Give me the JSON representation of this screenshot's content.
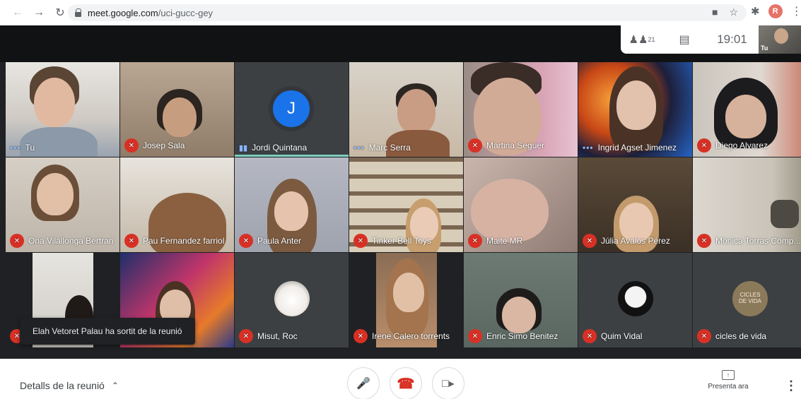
{
  "browser": {
    "url_host": "meet.google.com",
    "url_path": "/uci-gucc-gey",
    "profile_initial": "R"
  },
  "meet": {
    "participants_count": "21",
    "time": "19:01",
    "self_label": "Tu",
    "toast": "Elah Vetoret Palau ha sortit de la reunió",
    "avatar_j_letter": "J",
    "cicles_logo": "CICLES DE VIDA",
    "tiles": [
      {
        "name": "Tu",
        "state": "speaking-dots"
      },
      {
        "name": "Josep Sala",
        "state": "muted"
      },
      {
        "name": "Jordi Quintana",
        "state": "speaking-bars"
      },
      {
        "name": "Marc Serra",
        "state": "speaking-dots"
      },
      {
        "name": "Martina Seguer",
        "state": "muted"
      },
      {
        "name": "Ingrid Agset Jimenez",
        "state": "speaking-dots"
      },
      {
        "name": "Diego Alvarez",
        "state": "muted"
      },
      {
        "name": "Ona Vilallonga Bertran",
        "state": "muted"
      },
      {
        "name": "Pau Fernandez farriol",
        "state": "muted"
      },
      {
        "name": "Paula Anter",
        "state": "muted"
      },
      {
        "name": "Tinker Bell Toys",
        "state": "muted"
      },
      {
        "name": "Maite MR",
        "state": "muted"
      },
      {
        "name": "Júlia Avalos Pérez",
        "state": "muted"
      },
      {
        "name": "Mònica Torras Comp...",
        "state": "muted"
      },
      {
        "name": "",
        "state": "muted"
      },
      {
        "name": "",
        "state": "none"
      },
      {
        "name": "Misut, Roc",
        "state": "muted"
      },
      {
        "name": "Irene Calero torrents",
        "state": "muted"
      },
      {
        "name": "Enric Simo Benitez",
        "state": "muted"
      },
      {
        "name": "Quim Vidal",
        "state": "muted"
      },
      {
        "name": "cicles de vida",
        "state": "muted"
      }
    ]
  },
  "bottom_bar": {
    "details_label": "Detalls de la reunió",
    "present_label": "Presenta ara"
  },
  "icons": {
    "back": "back-arrow-icon",
    "forward": "forward-arrow-icon",
    "reload": "reload-icon",
    "lock": "lock-icon",
    "camera": "camera-icon",
    "star": "star-icon",
    "puzzle": "extensions-icon",
    "people": "people-icon",
    "chat": "chat-icon",
    "mic": "mic-icon",
    "hangup": "hangup-icon",
    "video": "video-icon",
    "present": "present-icon",
    "more": "more-vert-icon"
  },
  "colors": {
    "meet_bg": "#202124",
    "mute_red": "#d93025",
    "speaking_blue": "#8ab4f8",
    "avatar_blue": "#1a73e8"
  }
}
